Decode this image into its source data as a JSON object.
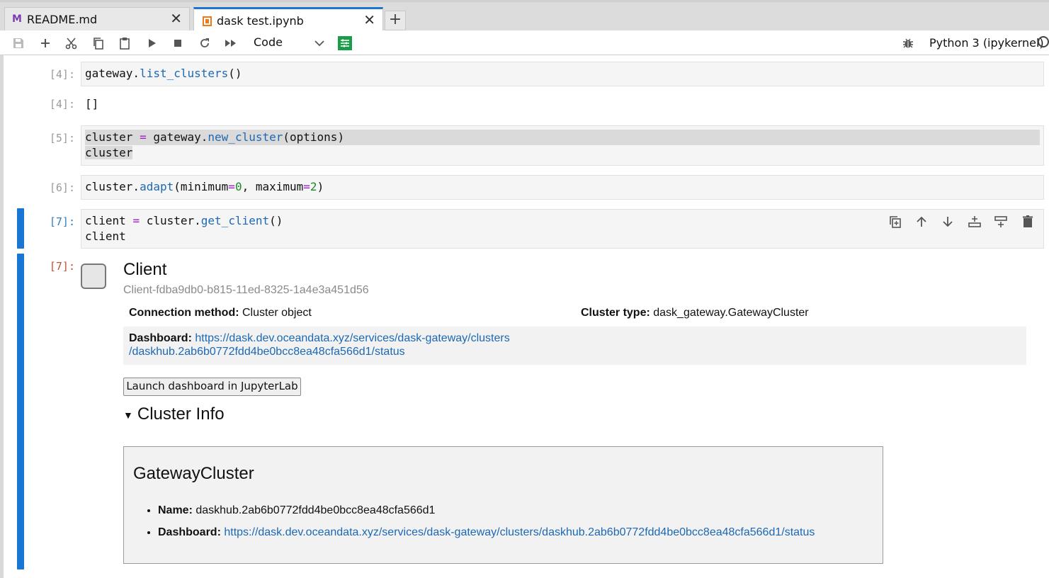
{
  "tabs": [
    {
      "icon": "markdown-icon",
      "label": "README.md",
      "active": false
    },
    {
      "icon": "notebook-icon",
      "label": "dask test.ipynb",
      "active": true
    }
  ],
  "toolbar": {
    "cell_type": "Code",
    "kernel": "Python 3 (ipykernel)",
    "icons": [
      "save-icon",
      "add-icon",
      "cut-icon",
      "copy-icon",
      "paste-icon",
      "run-icon",
      "stop-icon",
      "restart-icon",
      "fast-forward-icon",
      "property-inspector-icon",
      "debugger-icon"
    ]
  },
  "cells": {
    "c1": {
      "prompt": "[4]:",
      "line1_obj": "gateway.",
      "line1_fn": "list_clusters",
      "line1_tail": "()"
    },
    "o1": {
      "prompt": "[4]:",
      "text": "[]"
    },
    "c2": {
      "prompt": "[5]:",
      "a": "cluster ",
      "eq": "=",
      "b": " gateway.",
      "fn": "new_cluster",
      "c": "(options)",
      "line2": "cluster"
    },
    "c3": {
      "prompt": "[6]:",
      "a": "cluster.",
      "fn": "adapt",
      "b": "(minimum",
      "eq1": "=",
      "n1": "0",
      "c": ", maximum",
      "eq2": "=",
      "n2": "2",
      "d": ")"
    },
    "c4": {
      "prompt": "[7]:",
      "a": "client ",
      "eq": "=",
      "b": " cluster.",
      "fn": "get_client",
      "c": "()",
      "line2": "client"
    },
    "o4": {
      "prompt": "[7]:"
    }
  },
  "cell_actions": [
    "duplicate-icon",
    "move-up-icon",
    "move-down-icon",
    "insert-above-icon",
    "insert-below-icon",
    "delete-icon"
  ],
  "client": {
    "title": "Client",
    "id": "Client-fdba9db0-b815-11ed-8325-1a4e3a451d56",
    "connection_label": "Connection method:",
    "connection_value": "Cluster object",
    "cluster_type_label": "Cluster type:",
    "cluster_type_value": "dask_gateway.GatewayCluster",
    "dashboard_label": "Dashboard:",
    "dashboard_line1": "https://dask.dev.oceandata.xyz/services/dask-gateway/clusters",
    "dashboard_line2": "/daskhub.2ab6b0772fdd4be0bcc8ea48cfa566d1/status",
    "launch_button": "Launch dashboard in JupyterLab",
    "cluster_info": "Cluster Info"
  },
  "gateway_cluster": {
    "title": "GatewayCluster",
    "name_label": "Name:",
    "name_value": "daskhub.2ab6b0772fdd4be0bcc8ea48cfa566d1",
    "dashboard_label": "Dashboard:",
    "dashboard_value": "https://dask.dev.oceandata.xyz/services/dask-gateway/clusters/daskhub.2ab6b0772fdd4be0bcc8ea48cfa566d1/status"
  }
}
